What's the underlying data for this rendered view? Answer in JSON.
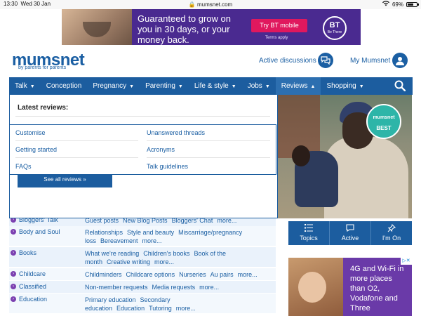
{
  "status_bar": {
    "time": "13:30",
    "date": "Wed 30 Jan",
    "url": "mumsnet.com",
    "battery": "69%"
  },
  "top_ad": {
    "text": "Guaranteed to grow on you in 30 days, or your money back.",
    "button": "Try BT mobile",
    "terms": "Terms apply",
    "brand": "BT",
    "brand_tag": "Be There"
  },
  "header": {
    "logo": "mumsnet",
    "tagline": "by parents for parents",
    "active_discussions": "Active discussions",
    "my_mumsnet": "My Mumsnet"
  },
  "nav": [
    {
      "label": "Talk",
      "caret": "▼"
    },
    {
      "label": "Conception",
      "caret": ""
    },
    {
      "label": "Pregnancy",
      "caret": "▼"
    },
    {
      "label": "Parenting",
      "caret": "▼"
    },
    {
      "label": "Life & style",
      "caret": "▼"
    },
    {
      "label": "Jobs",
      "caret": "▼"
    },
    {
      "label": "Reviews",
      "caret": "▲"
    },
    {
      "label": "Shopping",
      "caret": "▼"
    }
  ],
  "reviews_menu": {
    "title": "Latest reviews:",
    "links": [
      "Customise",
      "Unanswered threads",
      "Getting started",
      "Acronyms",
      "FAQs",
      "Talk guidelines"
    ],
    "see_all": "See all reviews »"
  },
  "hero_badge": {
    "brand": "mumsnet",
    "label": "BEST"
  },
  "tab_bar": [
    "Topics",
    "Active",
    "I'm On"
  ],
  "side_ad": {
    "text": "4G and Wi-Fi in more places than O2, Vodafone and Three"
  },
  "topics": [
    {
      "name": "Bloggers' Talk",
      "subs": [
        "Guest posts",
        "New Blog Posts",
        "Bloggers' Chat",
        "more..."
      ]
    },
    {
      "name": "Body and Soul",
      "subs": [
        "Relationships",
        "Style and beauty",
        "Miscarriage/pregnancy loss",
        "Bereavement",
        "more..."
      ]
    },
    {
      "name": "Books",
      "subs": [
        "What we're reading",
        "Children's books",
        "Book of the month",
        "Creative writing",
        "more..."
      ]
    },
    {
      "name": "Childcare",
      "subs": [
        "Childminders",
        "Childcare options",
        "Nurseries",
        "Au pairs",
        "more..."
      ]
    },
    {
      "name": "Classified",
      "subs": [
        "Non-member requests",
        "Media requests",
        "more..."
      ]
    },
    {
      "name": "Education",
      "subs": [
        "Primary education",
        "Secondary education",
        "Education",
        "Tutoring",
        "more..."
      ]
    }
  ],
  "colors": {
    "brand_blue": "#1c5d9f",
    "link_blue": "#1b5fa3",
    "row_tint": "#eaf2fb",
    "badge_teal": "#2db5a8"
  }
}
